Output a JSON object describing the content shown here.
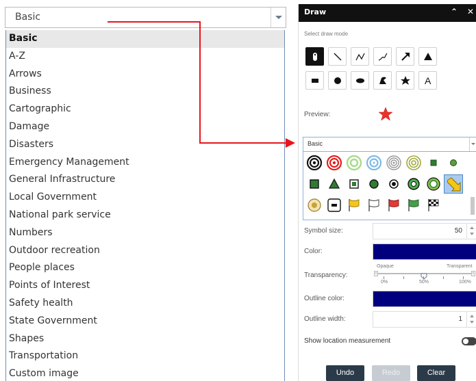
{
  "dropdown": {
    "selected": "Basic",
    "options": [
      "Basic",
      "A-Z",
      "Arrows",
      "Business",
      "Cartographic",
      "Damage",
      "Disasters",
      "Emergency Management",
      "General Infrastructure",
      "Local Government",
      "National park service",
      "Numbers",
      "Outdoor recreation",
      "People places",
      "Points of Interest",
      "Safety health",
      "State Government",
      "Shapes",
      "Transportation",
      "Custom image"
    ]
  },
  "annotation": {
    "color": "#e8141c"
  },
  "panel": {
    "title": "Draw",
    "header_icons": [
      "collapse-chevrons-icon",
      "close-icon"
    ],
    "select_mode_label": "Select draw mode",
    "draw_modes": [
      "point-icon",
      "line-icon",
      "polyline-icon",
      "freehand-line-icon",
      "arrow-icon",
      "triangle-icon",
      "rectangle-icon",
      "circle-icon",
      "ellipse-icon",
      "freehand-polygon-icon",
      "star-icon",
      "text-icon"
    ],
    "active_mode": "point-icon",
    "preview_label": "Preview:",
    "preview_symbol_color": "#e8332a",
    "symbol_set": "Basic",
    "symbol_size_label": "Symbol size:",
    "symbol_size": "50",
    "color_label": "Color:",
    "color": "#00007f",
    "transparency_label": "Transparency:",
    "transparency_min_label": "Opaque",
    "transparency_max_label": "Transparent",
    "transparency_ticks": [
      "0%",
      "50%",
      "100%"
    ],
    "transparency_value": 0.5,
    "outline_color_label": "Outline color:",
    "outline_color": "#00007f",
    "outline_width_label": "Outline width:",
    "outline_width": "1",
    "show_measurement_label": "Show location measurement",
    "show_measurement_on": false,
    "buttons": {
      "undo": "Undo",
      "redo": "Redo",
      "clear": "Clear"
    }
  }
}
